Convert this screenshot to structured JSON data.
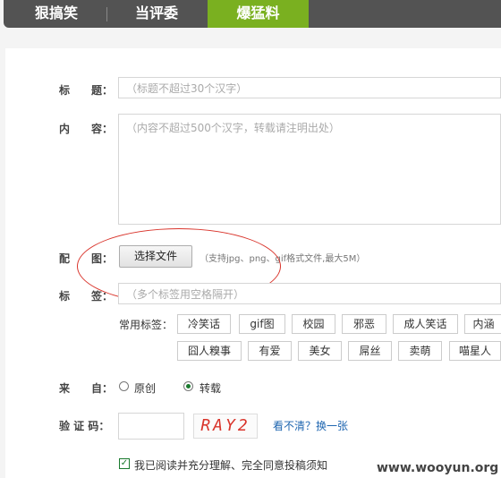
{
  "nav": {
    "tabs": [
      "狠搞笑",
      "当评委",
      "爆猛料"
    ],
    "active_index": 2,
    "active_color": "#7ab020"
  },
  "form": {
    "title_label": "标　　题：",
    "title_placeholder": "（标题不超过30个汉字）",
    "content_label": "内　　容：",
    "content_placeholder": "（内容不超过500个汉字，转载请注明出处）",
    "image_label": "配　　图：",
    "file_button": "选择文件",
    "file_hint": "（支持jpg、png、gif格式文件,最大5M）",
    "tags_label": "标　　签：",
    "tags_placeholder": "（多个标签用空格隔开）",
    "common_tags_label": "常用标签：",
    "common_tags_row1": [
      "冷笑话",
      "gif图",
      "校园",
      "邪恶",
      "成人笑话",
      "内涵"
    ],
    "common_tags_row2": [
      "囧人糗事",
      "有爱",
      "美女",
      "屌丝",
      "卖萌",
      "喵星人"
    ],
    "source_label": "来　　自：",
    "source_options": [
      "原创",
      "转载"
    ],
    "source_selected": "转载",
    "captcha_label": "验 证 码：",
    "captcha_text": "RAY2",
    "captcha_refresh": "看不清？换一张",
    "agree_text": "我已阅读并充分理解、完全同意投稿须知",
    "agree_checked": true
  },
  "watermark": "www.wooyun.org",
  "annotation_color": "#d9342b"
}
